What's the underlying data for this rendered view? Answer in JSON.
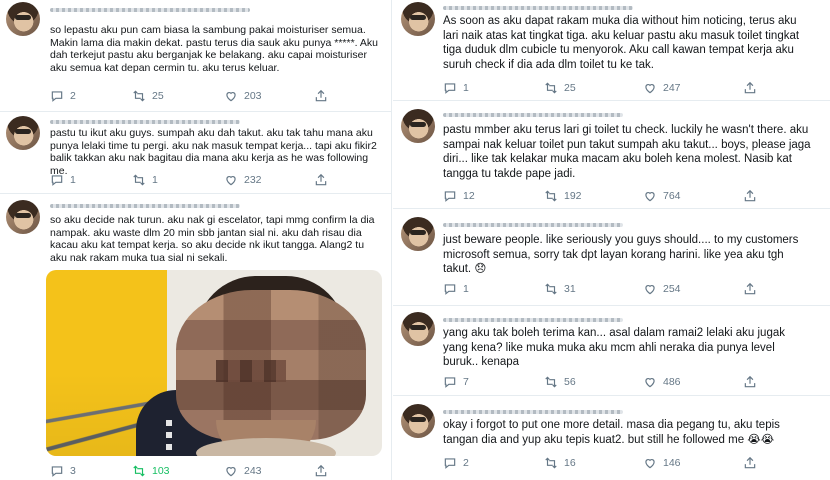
{
  "colors": {
    "text": "#14171a",
    "muted": "#657786",
    "retweet_active": "#17bf63",
    "divider": "#e6ecf0"
  },
  "icons": {
    "reply": "reply-icon",
    "retweet": "retweet-icon",
    "like": "heart-icon",
    "share": "share-icon"
  },
  "left": {
    "tweets": [
      {
        "text": "so lepastu aku pun cam biasa la sambung pakai moisturiser semua. Makin lama dia makin dekat. pastu terus dia sauk aku punya *****. Aku dah terkejut pastu aku berganjak ke belakang. aku capai moisturiser aku semua kat depan cermin tu. aku terus keluar.",
        "replies": "2",
        "retweets": "25",
        "likes": "203"
      },
      {
        "text": "pastu        tu ikut aku guys. sumpah aku dah takut. aku tak tahu mana aku punya lelaki time tu pergi. aku nak masuk tempat kerja... tapi aku fikir2 balik takkan aku nak bagitau dia mana aku kerja as he was following me.",
        "replies": "1",
        "retweets": "1",
        "likes": "232"
      },
      {
        "text": "so aku decide nak turun. aku nak gi escelator, tapi mmg confirm la dia nampak. aku waste dlm 20 min sbb jantan sial ni. aku dah risau dia kacau aku kat tempat kerja. so aku decide nk ikut tangga. Alang2 tu aku nak rakam muka tua sial ni sekali.",
        "replies": "3",
        "retweets": "103",
        "likes": "243"
      }
    ]
  },
  "right": {
    "tweets": [
      {
        "text": "As soon as aku dapat rakam muka dia without him noticing, terus aku lari naik atas kat tingkat tiga. aku keluar pastu aku masuk toilet tingkat tiga duduk dlm cubicle tu menyorok. Aku call kawan tempat kerja aku suruh check if dia ada dlm toilet tu ke tak.",
        "replies": "1",
        "retweets": "25",
        "likes": "247"
      },
      {
        "text": "pastu mmber aku terus lari gi toilet tu check. luckily he wasn't there. aku sampai nak keluar toilet pun takut     sumpah aku takut... boys, please jaga diri... like       tak kelakar         muka       macam aku boleh kena molest. Nasib kat tangga tu takde pape jadi.",
        "replies": "12",
        "retweets": "192",
        "likes": "764"
      },
      {
        "text": "just          beware people. like seriously you guys should.... to my customers microsoft semua, sorry tak dpt layan korang harini. like yea aku tgh takut. 😞",
        "replies": "1",
        "retweets": "31",
        "likes": "254"
      },
      {
        "text": "yang aku tak boleh terima kan... asal dalam ramai2 lelaki aku jugak yang kena? like       muka muka aku mcm ahli neraka dia punya level buruk.. kenapa",
        "replies": "7",
        "retweets": "56",
        "likes": "486"
      },
      {
        "text": "okay i forgot to put one more detail. masa dia pegang tu, aku tepis tangan dia and yup aku tepis kuat2. but still he followed me       😭😭",
        "replies": "2",
        "retweets": "16",
        "likes": "146"
      }
    ]
  }
}
